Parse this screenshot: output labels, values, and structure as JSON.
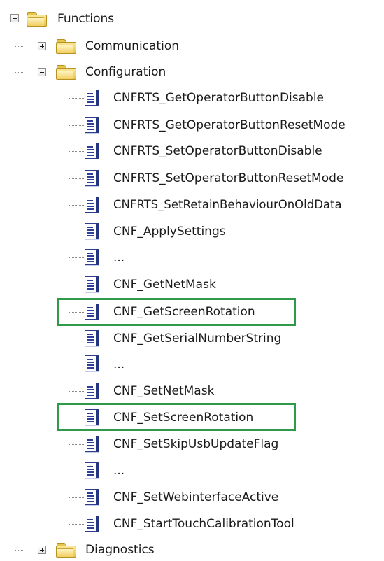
{
  "tree": {
    "functions_label": "Functions",
    "communication_label": "Communication",
    "configuration_label": "Configuration",
    "diagnostics_label": "Diagnostics",
    "configuration_items": [
      "CNFRTS_GetOperatorButtonDisable",
      "CNFRTS_GetOperatorButtonResetMode",
      "CNFRTS_SetOperatorButtonDisable",
      "CNFRTS_SetOperatorButtonResetMode",
      "CNFRTS_SetRetainBehaviourOnOldData",
      "CNF_ApplySettings",
      "...",
      "CNF_GetNetMask",
      "CNF_GetScreenRotation",
      "CNF_GetSerialNumberString",
      "...",
      "CNF_SetNetMask",
      "CNF_SetScreenRotation",
      "CNF_SetSkipUsbUpdateFlag",
      "...",
      "CNF_SetWebinterfaceActive",
      "CNF_StartTouchCalibrationTool"
    ]
  },
  "colors": {
    "highlight": "#2f9a4a",
    "folder": "#e9c24b",
    "document": "#2c3e97",
    "connector": "#8a8a8a"
  },
  "icons": {
    "folder": "folder-icon",
    "document": "document-icon",
    "collapse": "minus-box-icon",
    "expand": "plus-box-icon"
  }
}
